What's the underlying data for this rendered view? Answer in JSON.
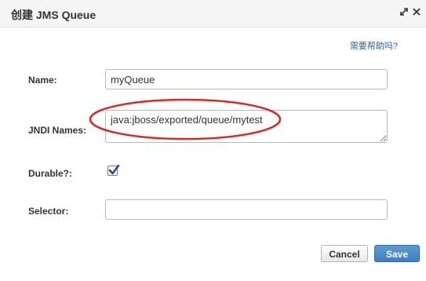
{
  "dialog": {
    "title": "创建 JMS Queue",
    "help_link": "需要帮助吗?",
    "icons": [
      "expand-icon",
      "close-icon"
    ]
  },
  "form": {
    "name": {
      "label": "Name:",
      "value": "myQueue"
    },
    "jndi": {
      "label": "JNDI Names:",
      "value": "java:jboss/exported/queue/mytest"
    },
    "durable": {
      "label": "Durable?:",
      "checked": true
    },
    "selector": {
      "label": "Selector:",
      "value": ""
    }
  },
  "buttons": {
    "cancel": "Cancel",
    "save": "Save"
  },
  "colors": {
    "accent": "#3d7ec0",
    "link": "#2a6496",
    "highlight_ring": "#d42a2a",
    "checkbox_mark": "#1f4f8a"
  }
}
